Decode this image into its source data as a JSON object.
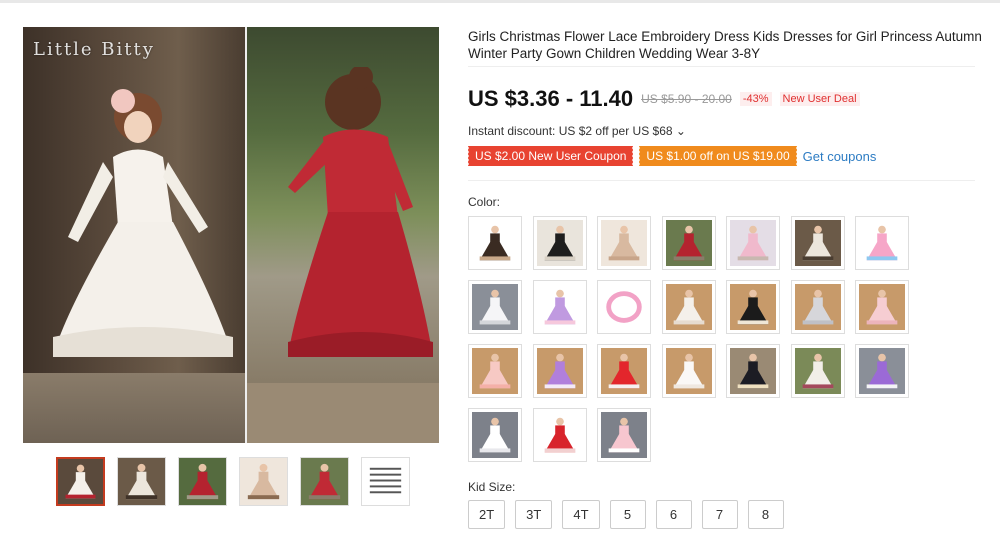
{
  "brand": "Little Bitty",
  "product": {
    "title": "Girls Christmas Flower Lace Embroidery Dress Kids Dresses for Girl Princess Autumn Winter Party Gown Children Wedding Wear 3-8Y",
    "price": "US $3.36 - 11.40",
    "original_price": "US $5.90 - 20.00",
    "discount_pct": "-43%",
    "deal_badge": "New User Deal",
    "instant_discount": "Instant discount: US $2 off per US $68 ⌄",
    "coupons": [
      {
        "label": "US $2.00 New User Coupon",
        "color": "#e84331"
      },
      {
        "label": "US $1.00 off on US $19.00",
        "color": "#f08b1d"
      }
    ],
    "get_coupons": "Get coupons"
  },
  "color_section": {
    "label": "Color:",
    "swatches": [
      {
        "icon": "tiered-black-dress",
        "tones": [
          "#ffffff",
          "#3a2b22",
          "#c9a98a"
        ]
      },
      {
        "icon": "girl-black-white-dress",
        "tones": [
          "#e9e4dc",
          "#1e1e1e",
          "#d8d0c4"
        ]
      },
      {
        "icon": "two-girls-beige",
        "tones": [
          "#efe6dc",
          "#d8b9a0",
          "#c8a58a"
        ]
      },
      {
        "icon": "girl-red-dress",
        "tones": [
          "#6a7a4e",
          "#b4232f",
          "#8a7c6a"
        ]
      },
      {
        "icon": "girl-pink-dress",
        "tones": [
          "#e4dde6",
          "#f0b9cc",
          "#c8b8b0"
        ]
      },
      {
        "icon": "girl-ivory-dress",
        "tones": [
          "#6b5a48",
          "#ece6dc",
          "#4a3d31"
        ]
      },
      {
        "icon": "rainbow-tutu",
        "tones": [
          "#ffffff",
          "#f6a6c8",
          "#8ec8f0"
        ]
      },
      {
        "icon": "white-tutu-dress",
        "tones": [
          "#8a8f98",
          "#f5f5f7",
          "#d4d6da"
        ]
      },
      {
        "icon": "lavender-tutu-dress",
        "tones": [
          "#ffffff",
          "#c09ae0",
          "#f6c8dc"
        ]
      },
      {
        "icon": "flower-crown",
        "tones": [
          "#ffffff",
          "#f2a2c6",
          "#8ac4e8"
        ]
      },
      {
        "icon": "ivory-tutu-dress",
        "tones": [
          "#c79a6a",
          "#f4f0ea",
          "#e6dcd0"
        ]
      },
      {
        "icon": "black-sequin-dress",
        "tones": [
          "#c79a6a",
          "#1b1b1b",
          "#efe6d6"
        ]
      },
      {
        "icon": "grey-tutu-dress",
        "tones": [
          "#c79a6a",
          "#d6d6da",
          "#bfc0c6"
        ]
      },
      {
        "icon": "blush-tutu-dress",
        "tones": [
          "#c79a6a",
          "#f6cdd2",
          "#ecb4bc"
        ]
      },
      {
        "icon": "peach-tutu-dress",
        "tones": [
          "#c79a6a",
          "#f7c9c4",
          "#f4b0a8"
        ]
      },
      {
        "icon": "purple-tutu-dress",
        "tones": [
          "#c79a6a",
          "#b17fdc",
          "#f3eaf8"
        ]
      },
      {
        "icon": "red-tutu-dress",
        "tones": [
          "#c79a6a",
          "#e3262c",
          "#f6f0f0"
        ]
      },
      {
        "icon": "white-layered-dress",
        "tones": [
          "#c79a6a",
          "#faf8f6",
          "#efe8e0"
        ]
      },
      {
        "icon": "black-star-dress",
        "tones": [
          "#9a8a74",
          "#1c1c24",
          "#efe0c0"
        ]
      },
      {
        "icon": "floral-print-dress",
        "tones": [
          "#7b8a58",
          "#f2eee8",
          "#a4485c"
        ]
      },
      {
        "icon": "violet-tutu-dress",
        "tones": [
          "#8a8f98",
          "#9b6ad6",
          "#f4f4f6"
        ]
      },
      {
        "icon": "white-ruffle-dress",
        "tones": [
          "#7d818a",
          "#ffffff",
          "#e8e8ec"
        ]
      },
      {
        "icon": "red-ruffle-dress",
        "tones": [
          "#ffffff",
          "#d8242c",
          "#f2d0d0"
        ]
      },
      {
        "icon": "pink-ruffle-dress",
        "tones": [
          "#7d818a",
          "#f7c6cf",
          "#ffffff"
        ]
      }
    ]
  },
  "size_section": {
    "label": "Kid Size:",
    "sizes": [
      "2T",
      "3T",
      "4T",
      "5",
      "6",
      "7",
      "8"
    ]
  },
  "thumbnails": [
    {
      "icon": "two-girls-white-red",
      "tones": [
        "#5a4a3c",
        "#f4f0ea",
        "#b4232f"
      ]
    },
    {
      "icon": "girl-ivory-dress",
      "tones": [
        "#6b5a48",
        "#ece6dc",
        "#3f3228"
      ]
    },
    {
      "icon": "girl-red-dress",
      "tones": [
        "#556b3f",
        "#b4232f",
        "#a09a88"
      ]
    },
    {
      "icon": "two-girls-beige",
      "tones": [
        "#efe6dc",
        "#d8b9a0",
        "#8a6a50"
      ]
    },
    {
      "icon": "girl-red-dress",
      "tones": [
        "#6a7a4e",
        "#c02a35",
        "#8a7c6a"
      ]
    },
    {
      "icon": "size-chart",
      "tones": [
        "#ffffff",
        "#555555",
        "#dddddd"
      ]
    }
  ]
}
